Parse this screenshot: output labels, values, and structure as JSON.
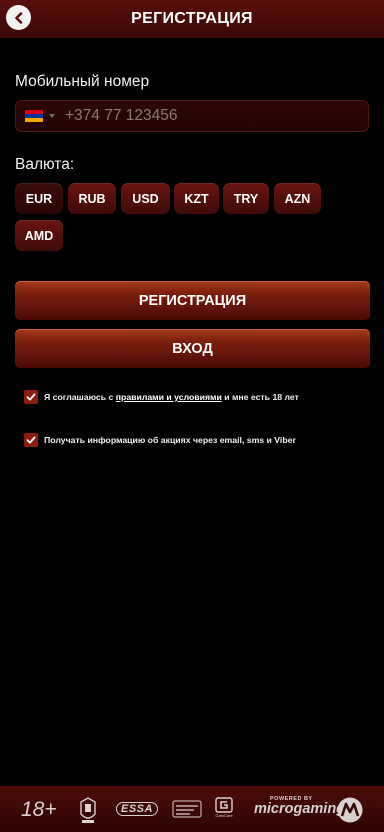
{
  "header": {
    "title": "РЕГИСТРАЦИЯ"
  },
  "phone": {
    "label": "Мобильный номер",
    "placeholder": "+374 77 123456",
    "country_flag": "Armenia"
  },
  "currency": {
    "label": "Валюта:",
    "options": [
      "EUR",
      "RUB",
      "USD",
      "KZT",
      "TRY",
      "AZN",
      "AMD"
    ],
    "selected": "EUR"
  },
  "buttons": {
    "register": "РЕГИСТРАЦИЯ",
    "login": "ВХОД"
  },
  "terms": {
    "prefix": "Я соглашаюсь с ",
    "link": "правилами и условиями",
    "suffix": " и мне есть 18 лет",
    "checked": true
  },
  "promo": {
    "text": "Получать информацию об акциях через email, sms и Viber",
    "checked": true
  },
  "footer": {
    "age": "18+",
    "essa": "ESSA",
    "gamcare": "GamCare",
    "powered_by": "POWERED BY",
    "microgaming": "microgaming"
  },
  "colors": {
    "accent": "#8a1e10",
    "header": "#4a0c09",
    "button_top": "#a83a1a"
  }
}
